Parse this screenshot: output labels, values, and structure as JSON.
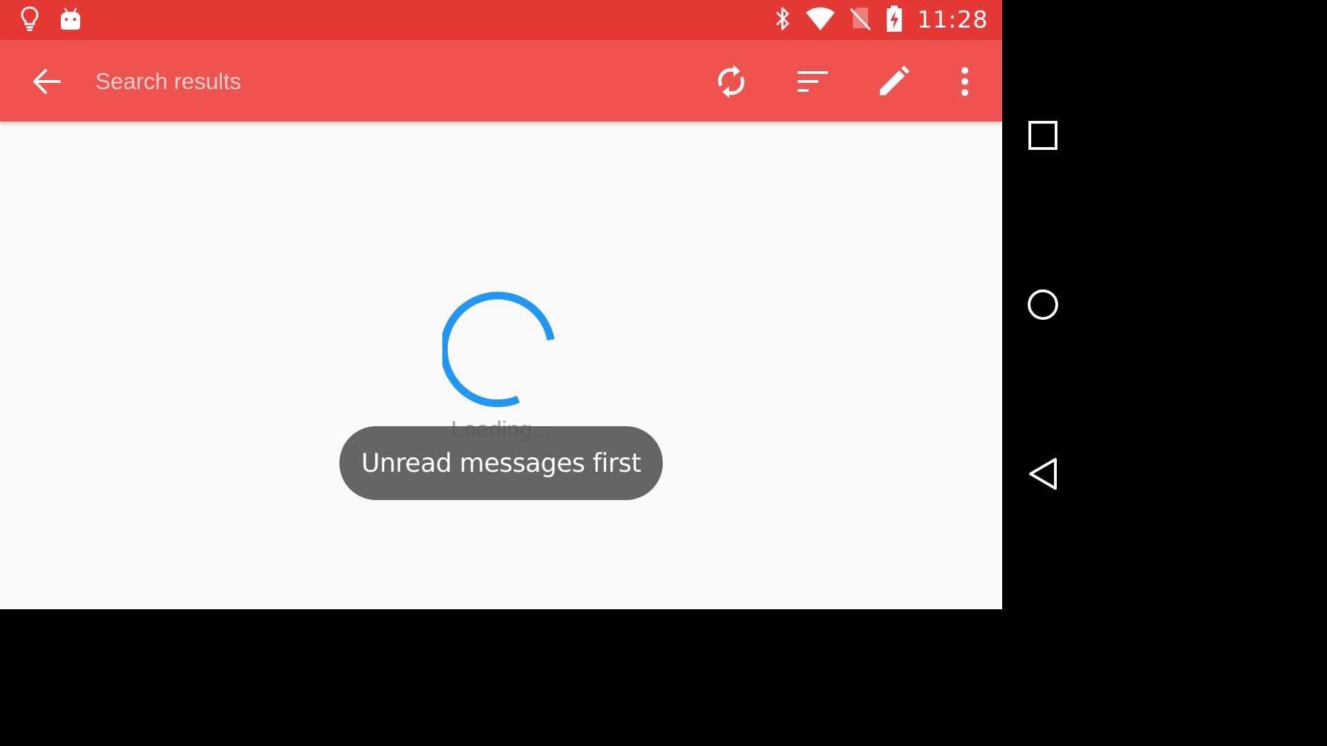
{
  "status_bar": {
    "time": "11:28",
    "background": "#e53935",
    "left_icons": [
      "lightbulb-icon",
      "android-icon"
    ],
    "right_icons": [
      "bluetooth-icon",
      "wifi-icon",
      "no-sim-icon",
      "battery-charging-icon"
    ]
  },
  "app_bar": {
    "title": "Search results",
    "background": "#ef5350",
    "actions": [
      "sync-icon",
      "sort-icon",
      "compose-icon",
      "more-vert-icon"
    ]
  },
  "content": {
    "loading_text": "Loading...",
    "spinner_color": "#2196f3"
  },
  "toast": {
    "text": "Unread messages first"
  },
  "nav_bar": {
    "buttons": [
      "recents-icon",
      "home-icon",
      "back-icon"
    ]
  }
}
